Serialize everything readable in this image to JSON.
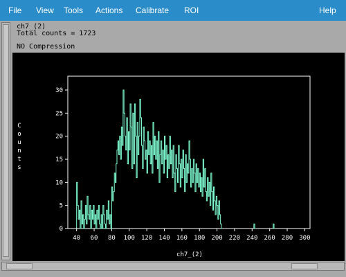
{
  "menu": {
    "items": [
      "File",
      "View",
      "Tools",
      "Actions",
      "Calibrate",
      "ROI"
    ],
    "help": "Help"
  },
  "info": {
    "name": "ch7_(2)",
    "total": "Total counts = 1723",
    "compression": "NO Compression"
  },
  "colors": {
    "menubar": "#2a8cc8",
    "histogram": "#7fffd4",
    "axes": "#ffffff"
  },
  "chart_data": {
    "type": "line",
    "title": "",
    "xlabel": "ch7_(2)",
    "ylabel": "Counts",
    "xlim": [
      30,
      306
    ],
    "ylim": [
      0,
      33
    ],
    "xticks": [
      40,
      60,
      80,
      100,
      120,
      140,
      160,
      180,
      200,
      220,
      240,
      260,
      280,
      300
    ],
    "yticks": [
      0,
      5,
      10,
      15,
      20,
      25,
      30
    ],
    "bin_width": 1,
    "series": [
      {
        "x": [
          40,
          41,
          42,
          43,
          44,
          45,
          46,
          47,
          48,
          49,
          50,
          51,
          52,
          53,
          54,
          55,
          56,
          57,
          58,
          59,
          60,
          61,
          62,
          63,
          64,
          65,
          66,
          67,
          68,
          69,
          70,
          71,
          72,
          73,
          74,
          75,
          76,
          77,
          78,
          79,
          80,
          81,
          82,
          83,
          84,
          85,
          86,
          87,
          88,
          89,
          90,
          91,
          92,
          93,
          94,
          95,
          96,
          97,
          98,
          99,
          100,
          101,
          102,
          103,
          104,
          105,
          106,
          107,
          108,
          109,
          110,
          111,
          112,
          113,
          114,
          115,
          116,
          117,
          118,
          119,
          120,
          121,
          122,
          123,
          124,
          125,
          126,
          127,
          128,
          129,
          130,
          131,
          132,
          133,
          134,
          135,
          136,
          137,
          138,
          139,
          140,
          141,
          142,
          143,
          144,
          145,
          146,
          147,
          148,
          149,
          150,
          151,
          152,
          153,
          154,
          155,
          156,
          157,
          158,
          159,
          160,
          161,
          162,
          163,
          164,
          165,
          166,
          167,
          168,
          169,
          170,
          171,
          172,
          173,
          174,
          175,
          176,
          177,
          178,
          179,
          180,
          181,
          182,
          183,
          184,
          185,
          186,
          187,
          188,
          189,
          190,
          191,
          192,
          193,
          194,
          195,
          196,
          197,
          198,
          199,
          200,
          201,
          202,
          203,
          204,
          205,
          242,
          243,
          264,
          265
        ],
        "y": [
          10,
          5,
          2,
          4,
          0,
          6,
          1,
          3,
          0,
          2,
          5,
          1,
          7,
          3,
          2,
          5,
          0,
          4,
          2,
          5,
          1,
          3,
          0,
          4,
          2,
          5,
          1,
          0,
          3,
          0,
          5,
          3,
          1,
          0,
          4,
          2,
          6,
          1,
          3,
          0,
          9,
          6,
          8,
          12,
          10,
          14,
          17,
          19,
          16,
          20,
          15,
          22,
          18,
          30,
          25,
          20,
          17,
          24,
          14,
          21,
          17,
          27,
          22,
          13,
          25,
          14,
          27,
          20,
          11,
          23,
          16,
          20,
          28,
          24,
          18,
          13,
          22,
          19,
          15,
          17,
          12,
          21,
          16,
          19,
          14,
          18,
          12,
          23,
          16,
          20,
          15,
          19,
          13,
          21,
          10,
          16,
          19,
          14,
          17,
          12,
          20,
          15,
          18,
          11,
          16,
          13,
          20,
          14,
          17,
          11,
          18,
          12,
          8,
          16,
          13,
          10,
          18,
          14,
          9,
          15,
          11,
          17,
          13,
          8,
          16,
          10,
          14,
          12,
          19,
          15,
          9,
          13,
          10,
          15,
          12,
          8,
          14,
          10,
          13,
          9,
          12,
          8,
          11,
          7,
          15,
          9,
          13,
          8,
          6,
          11,
          7,
          10,
          5,
          12,
          8,
          4,
          9,
          6,
          3,
          7,
          5,
          2,
          6,
          3,
          1,
          0,
          1,
          0,
          1,
          0
        ]
      }
    ]
  }
}
